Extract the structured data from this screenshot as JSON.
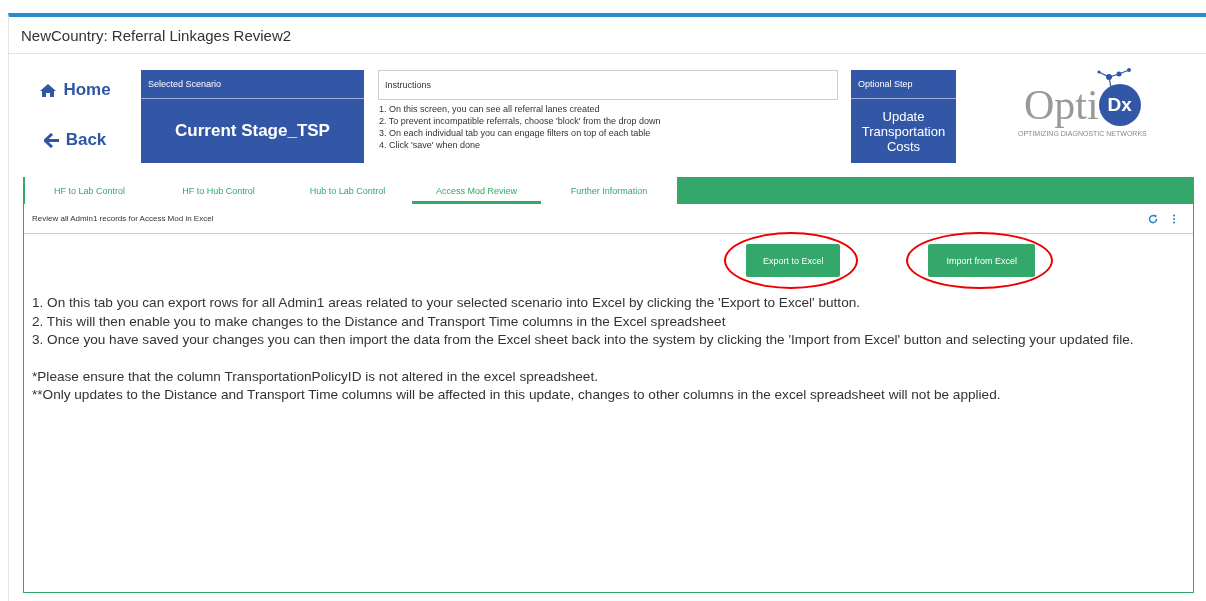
{
  "window": {
    "title": "NewCountry: Referral Linkages Review2"
  },
  "nav": [
    {
      "kind": "home",
      "label": "Home"
    },
    {
      "kind": "back",
      "label": "Back"
    }
  ],
  "scenario": {
    "header": "Selected Scenario",
    "value": "Current Stage_TSP"
  },
  "instructions": {
    "header": "Instructions",
    "lines": [
      "1. On this screen, you can see all referral lanes created",
      "2. To prevent incompatible referrals, choose 'block' from the drop down",
      "3. On each individual tab you can engage filters on top of each table",
      "4. Click 'save' when done"
    ]
  },
  "optional_step": {
    "header": "Optional Step",
    "value": "Update Transportation Costs"
  },
  "logo": {
    "word": "Opti",
    "badge": "Dx",
    "tagline": "OPTIMIZING DIAGNOSTIC NETWORKS"
  },
  "tabs": [
    {
      "label": "HF to Lab Control",
      "selected": false
    },
    {
      "label": "HF to Hub Control",
      "selected": false
    },
    {
      "label": "Hub to Lab Control",
      "selected": false
    },
    {
      "label": "Access Mod Review",
      "selected": true
    },
    {
      "label": "Further Information",
      "selected": false
    }
  ],
  "panel": {
    "caption": "Review all Admin1 records for Access Mod in Excel",
    "buttons": [
      {
        "label": "Export to Excel",
        "circled": true
      },
      {
        "label": "Import from Excel",
        "circled": true
      }
    ],
    "steps": [
      "1. On this tab you can export rows for all Admin1 areas related to your selected scenario into Excel by clicking the 'Export to Excel' button.",
      "2. This will then enable you to make changes to the Distance and Transport Time columns in the Excel spreadsheet",
      "3. Once you have saved your changes you can then import the data from the Excel sheet back into the system by clicking the 'Import from Excel' button and selecting your updated file."
    ],
    "notes": [
      "*Please ensure that the column TransportationPolicyID is not altered in the excel spreadsheet.",
      "**Only updates to the Distance and Transport Time columns will be affected in this update, changes to other columns in the excel spreadsheet will not be applied."
    ]
  }
}
